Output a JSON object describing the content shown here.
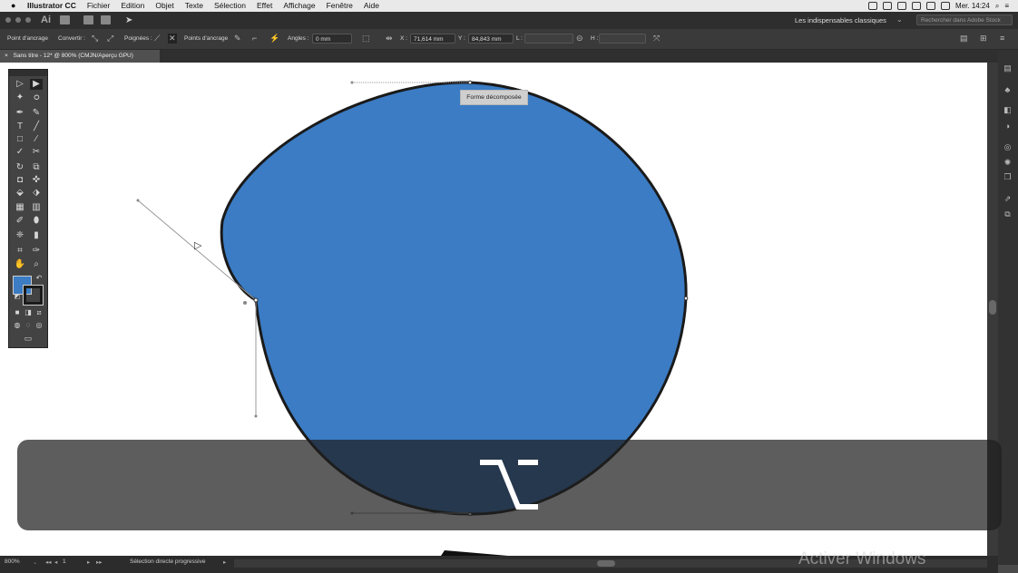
{
  "menubar": {
    "apple": "",
    "menus": [
      "Illustrator CC",
      "Fichier",
      "Edition",
      "Objet",
      "Texte",
      "Sélection",
      "Effet",
      "Affichage",
      "Fenêtre",
      "Aide"
    ],
    "clock": "Mer. 14:24"
  },
  "appbar": {
    "logo": "Ai",
    "workspace": "Les indispensables classiques",
    "search_placeholder": "Rechercher dans Adobe Stock"
  },
  "control_bar": {
    "anchor_point_label": "Point d'ancrage",
    "convert_label": "Convertir :",
    "handles_label": "Poignées :",
    "anchor_points_label": "Points d'ancrage",
    "corners_label": "Angles :",
    "corners_value": "0 mm",
    "x_label": "X :",
    "x_value": "71,614 mm",
    "y_label": "Y :",
    "y_value": "84,843 mm",
    "w_label": "L :",
    "h_label": "H :"
  },
  "document_tab": {
    "close": "×",
    "title": "Sans titre - 12* @ 800% (CMJN/Aperçu GPU)"
  },
  "canvas": {
    "tooltip": "Forme décomposée",
    "shape_fill": "#3b7cc4",
    "path_stroke": "#1a1a1a",
    "guide_color": "#999999"
  },
  "toolbox": {
    "fill_color": "#3b7cc4",
    "stroke_color": "#1a1a1a"
  },
  "key_overlay": {
    "key_symbol": "⌥"
  },
  "status_bar": {
    "zoom": "800%",
    "artboard": "1",
    "tool": "Sélection directe progressive"
  },
  "watermark": "Activer Windows"
}
